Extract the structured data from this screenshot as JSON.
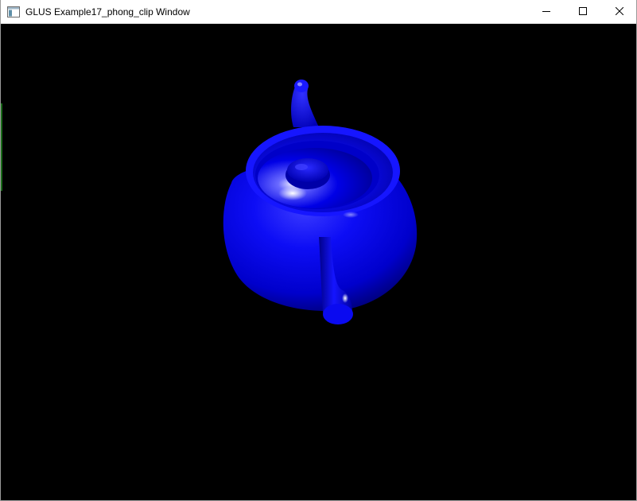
{
  "window": {
    "title": "GLUS Example17_phong_clip Window",
    "icon": "app-window-icon",
    "controls": {
      "minimize_icon": "minimize-icon",
      "maximize_icon": "maximize-icon",
      "close_icon": "close-icon"
    }
  },
  "scene": {
    "object": "teapot",
    "object_color": "#0000ff",
    "background_color": "#000000"
  }
}
